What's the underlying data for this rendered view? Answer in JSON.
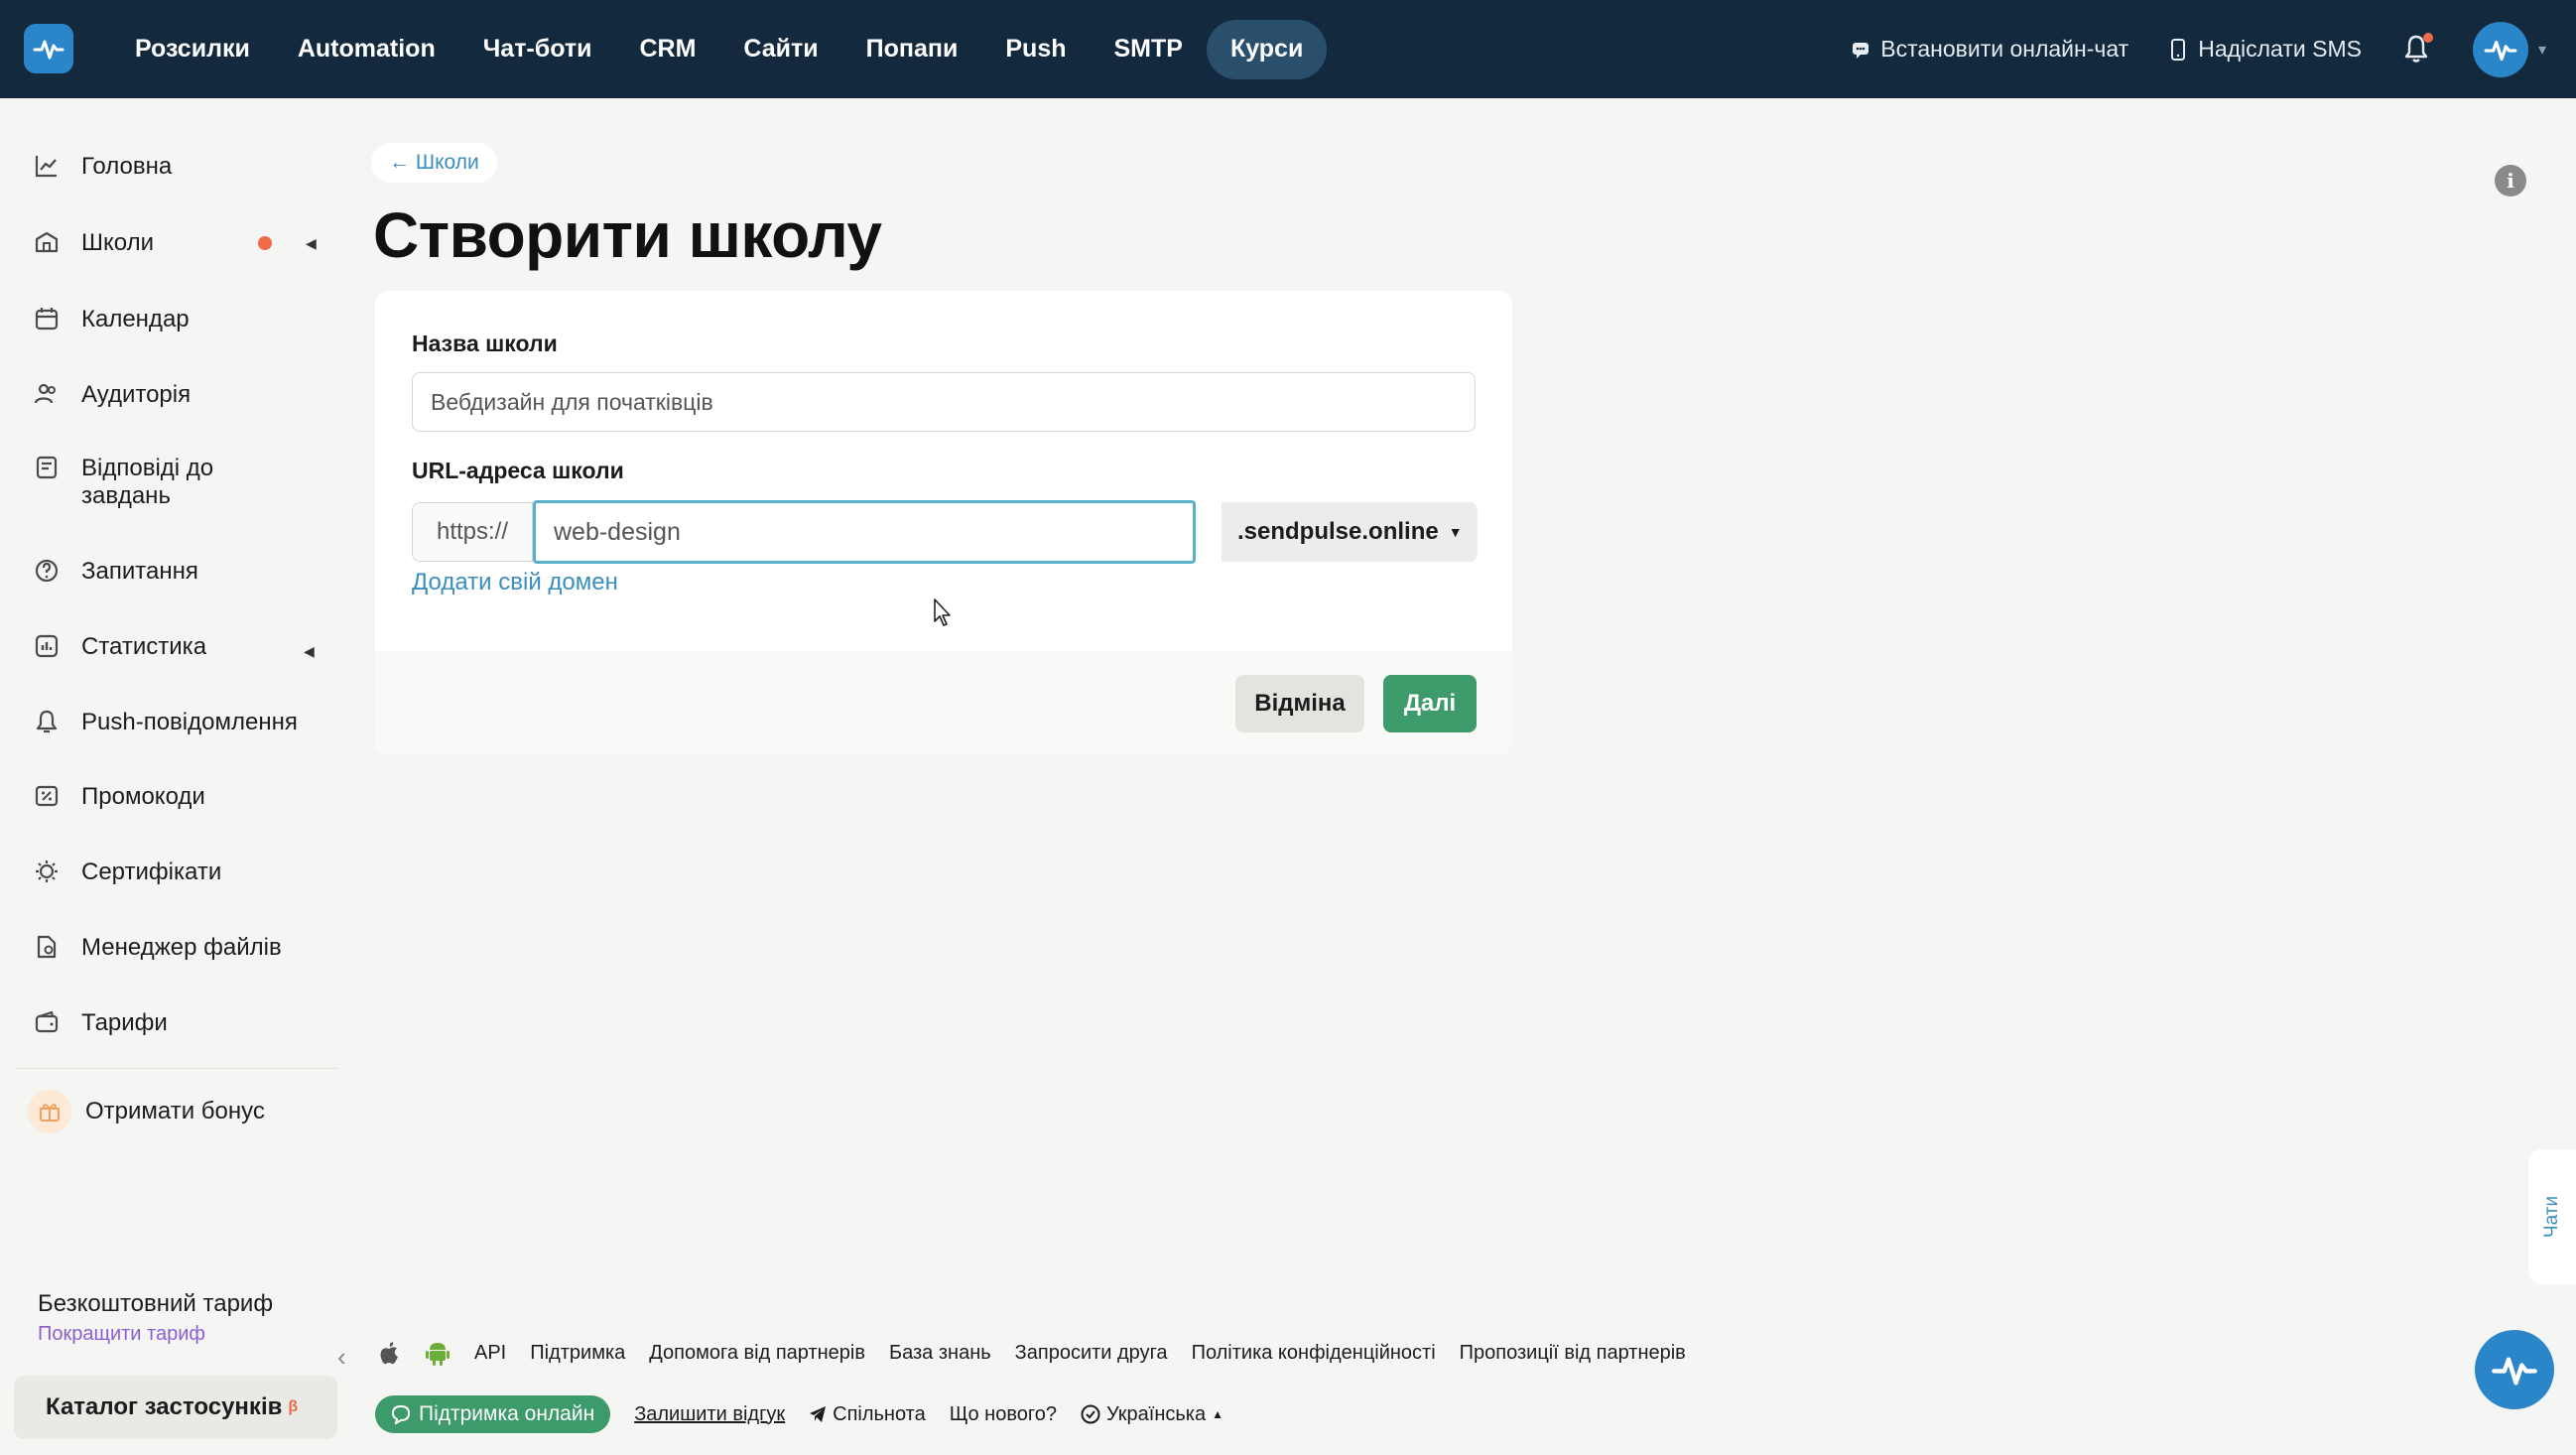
{
  "topbar": {
    "nav": [
      "Розсилки",
      "Automation",
      "Чат-боти",
      "CRM",
      "Сайти",
      "Попапи",
      "Push",
      "SMTP",
      "Курси"
    ],
    "install_chat": "Встановити онлайн-чат",
    "send_sms": "Надіслати SMS"
  },
  "sidebar": {
    "items": [
      {
        "label": "Головна",
        "icon": "chart-line-icon"
      },
      {
        "label": "Школи",
        "icon": "school-icon"
      },
      {
        "label": "Календар",
        "icon": "calendar-icon"
      },
      {
        "label": "Аудиторія",
        "icon": "users-icon"
      },
      {
        "label": "Відповіді до завдань",
        "icon": "answers-icon"
      },
      {
        "label": "Запитання",
        "icon": "question-icon"
      },
      {
        "label": "Статистика",
        "icon": "stats-icon"
      },
      {
        "label": "Push-повідомлення",
        "icon": "bell-icon"
      },
      {
        "label": "Промокоди",
        "icon": "promo-icon"
      },
      {
        "label": "Сертифікати",
        "icon": "certificate-icon"
      },
      {
        "label": "Менеджер файлів",
        "icon": "files-icon"
      },
      {
        "label": "Тарифи",
        "icon": "wallet-icon"
      }
    ],
    "bonus": "Отримати бонус",
    "plan_title": "Безкоштовний тариф",
    "plan_link": "Покращити тариф",
    "catalog": "Каталог застосунків",
    "catalog_badge": "β"
  },
  "main": {
    "back": "← Школи",
    "title": "Створити школу",
    "name_label": "Назва школи",
    "name_placeholder": "Вебдизайн для початківців",
    "url_label": "URL-адреса школи",
    "url_prefix": "https://",
    "url_value": "web-design",
    "domain": ".sendpulse.online",
    "add_domain": "Додати свій домен",
    "cancel": "Відміна",
    "next": "Далі"
  },
  "footer": {
    "links": [
      "API",
      "Підтримка",
      "Допомога від партнерів",
      "База знань",
      "Запросити друга",
      "Політика конфіденційності",
      "Пропозиції від партнерів"
    ],
    "support_online": "Підтримка онлайн",
    "feedback": "Залишити відгук",
    "community": "Спільнота",
    "whats_new": "Що нового?",
    "language": "Українська"
  },
  "chats_tab": "Чати",
  "colors": {
    "topbar": "#13293d",
    "accent": "#3d9a6a",
    "link": "#3a8dbf",
    "brand": "#2b86c9"
  }
}
